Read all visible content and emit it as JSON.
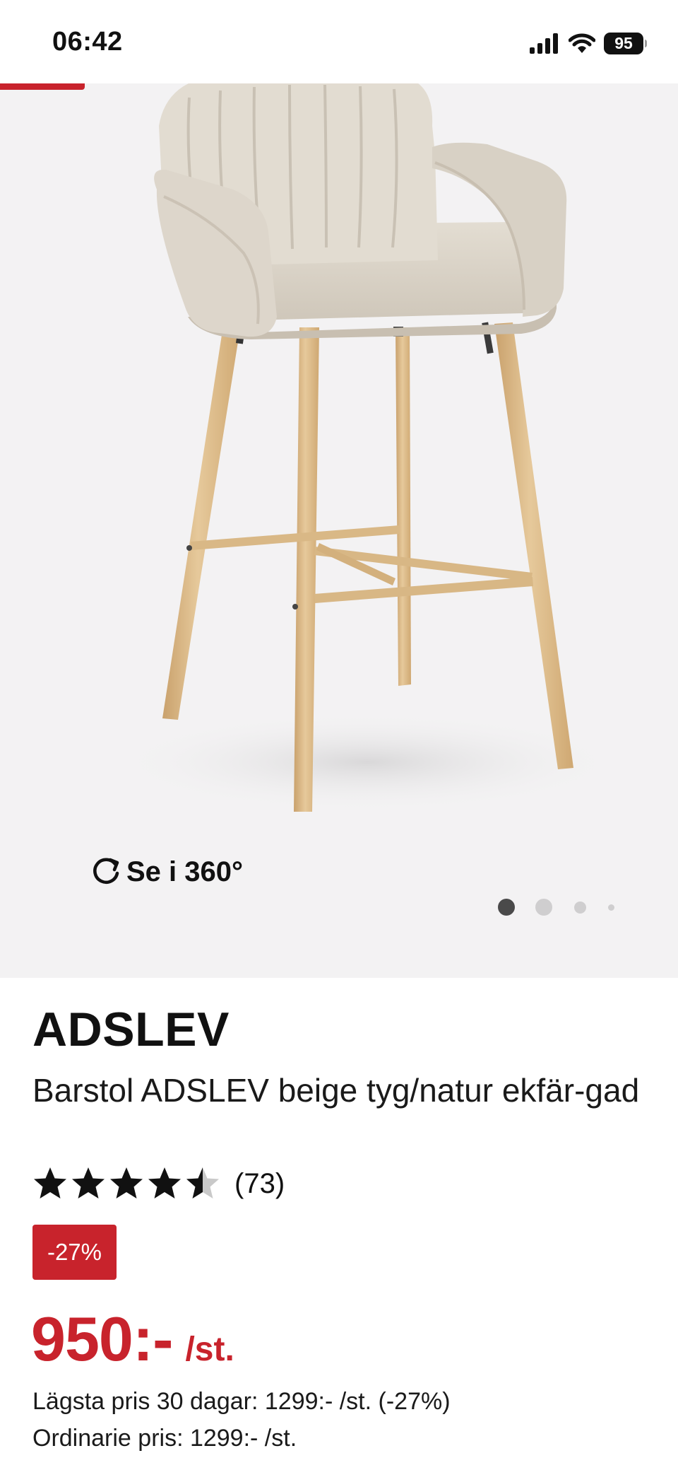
{
  "status_bar": {
    "time": "06:42",
    "battery": "95"
  },
  "gallery": {
    "view_360_label": "Se i 360°",
    "slide_count": 4,
    "active_slide": 0
  },
  "product": {
    "name": "ADSLEV",
    "description": "Barstol ADSLEV beige tyg/natur ekfär-gad",
    "rating": 4.5,
    "review_count": "(73)",
    "discount": "-27%",
    "price": "950:-",
    "price_unit": "/st.",
    "lowest_price": "Lägsta pris 30 dagar: 1299:- /st. (-27%)",
    "regular_price": "Ordinarie pris: 1299:- /st."
  },
  "colors": {
    "brand_red": "#c8232c",
    "gallery_bg": "#f3f2f3",
    "fabric": "#ddd6cb",
    "wood": "#dcbb8c"
  }
}
